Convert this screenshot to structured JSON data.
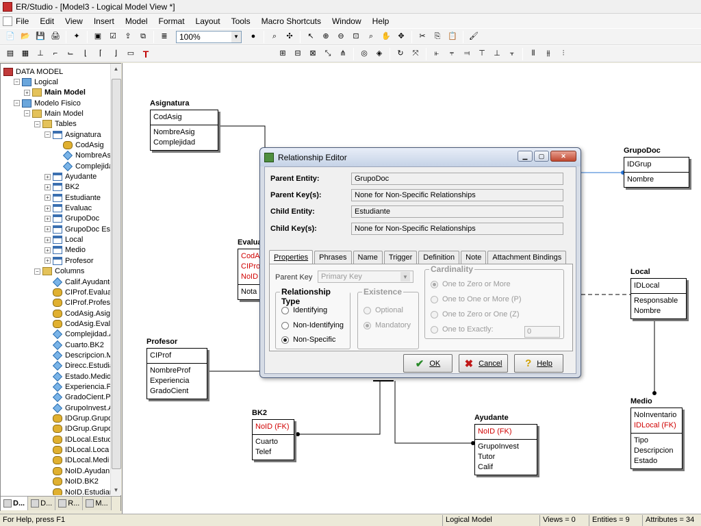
{
  "window": {
    "title": "ER/Studio - [Model3 - Logical Model View *]"
  },
  "menu": [
    "File",
    "Edit",
    "View",
    "Insert",
    "Model",
    "Format",
    "Layout",
    "Tools",
    "Macro Shortcuts",
    "Window",
    "Help"
  ],
  "toolbar": {
    "zoom": "100%"
  },
  "tree": {
    "items": [
      {
        "label": "DATA MODEL",
        "depth": 0,
        "icon": "database-icon",
        "bold": false,
        "expander": ""
      },
      {
        "label": "Logical",
        "depth": 1,
        "icon": "logical-model-icon",
        "bold": false,
        "expander": "−"
      },
      {
        "label": "Main Model",
        "depth": 2,
        "icon": "model-folder-icon",
        "bold": true,
        "expander": "+"
      },
      {
        "label": "Modelo Fisico",
        "depth": 1,
        "icon": "physical-model-icon",
        "bold": false,
        "expander": "−"
      },
      {
        "label": "Main Model",
        "depth": 2,
        "icon": "model-folder-icon",
        "bold": false,
        "expander": "−"
      },
      {
        "label": "Tables",
        "depth": 3,
        "icon": "tables-folder-icon",
        "bold": false,
        "expander": "−"
      },
      {
        "label": "Asignatura",
        "depth": 4,
        "icon": "table-icon",
        "bold": false,
        "expander": "−"
      },
      {
        "label": "CodAsig",
        "depth": 5,
        "icon": "key-column-icon",
        "bold": false,
        "expander": ""
      },
      {
        "label": "NombreAsig",
        "depth": 5,
        "icon": "column-icon",
        "bold": false,
        "expander": ""
      },
      {
        "label": "Complejidad",
        "depth": 5,
        "icon": "column-icon",
        "bold": false,
        "expander": ""
      },
      {
        "label": "Ayudante",
        "depth": 4,
        "icon": "table-icon",
        "bold": false,
        "expander": "+"
      },
      {
        "label": "BK2",
        "depth": 4,
        "icon": "table-icon",
        "bold": false,
        "expander": "+"
      },
      {
        "label": "Estudiante",
        "depth": 4,
        "icon": "table-icon",
        "bold": false,
        "expander": "+"
      },
      {
        "label": "Evaluac",
        "depth": 4,
        "icon": "table-icon",
        "bold": false,
        "expander": "+"
      },
      {
        "label": "GrupoDoc",
        "depth": 4,
        "icon": "table-icon",
        "bold": false,
        "expander": "+"
      },
      {
        "label": "GrupoDoc Es",
        "depth": 4,
        "icon": "table-icon",
        "bold": false,
        "expander": "+"
      },
      {
        "label": "Local",
        "depth": 4,
        "icon": "table-icon",
        "bold": false,
        "expander": "+"
      },
      {
        "label": "Medio",
        "depth": 4,
        "icon": "table-icon",
        "bold": false,
        "expander": "+"
      },
      {
        "label": "Profesor",
        "depth": 4,
        "icon": "table-icon",
        "bold": false,
        "expander": "+"
      },
      {
        "label": "Columns",
        "depth": 3,
        "icon": "columns-folder-icon",
        "bold": false,
        "expander": "−"
      },
      {
        "label": "Calif.Ayudante",
        "depth": 4,
        "icon": "column-icon",
        "bold": false,
        "expander": ""
      },
      {
        "label": "CIProf.Evalua",
        "depth": 4,
        "icon": "key-column-icon",
        "bold": false,
        "expander": ""
      },
      {
        "label": "CIProf.Profes",
        "depth": 4,
        "icon": "key-column-icon",
        "bold": false,
        "expander": ""
      },
      {
        "label": "CodAsig.Asign",
        "depth": 4,
        "icon": "key-column-icon",
        "bold": false,
        "expander": ""
      },
      {
        "label": "CodAsig.Evalu",
        "depth": 4,
        "icon": "key-column-icon",
        "bold": false,
        "expander": ""
      },
      {
        "label": "Complejidad.A",
        "depth": 4,
        "icon": "column-icon",
        "bold": false,
        "expander": ""
      },
      {
        "label": "Cuarto.BK2",
        "depth": 4,
        "icon": "column-icon",
        "bold": false,
        "expander": ""
      },
      {
        "label": "Descripcion.M",
        "depth": 4,
        "icon": "column-icon",
        "bold": false,
        "expander": ""
      },
      {
        "label": "Direcc.Estudia",
        "depth": 4,
        "icon": "column-icon",
        "bold": false,
        "expander": ""
      },
      {
        "label": "Estado.Medio",
        "depth": 4,
        "icon": "column-icon",
        "bold": false,
        "expander": ""
      },
      {
        "label": "Experiencia.P",
        "depth": 4,
        "icon": "column-icon",
        "bold": false,
        "expander": ""
      },
      {
        "label": "GradoCient.Pr",
        "depth": 4,
        "icon": "column-icon",
        "bold": false,
        "expander": ""
      },
      {
        "label": "GrupoInvest.A",
        "depth": 4,
        "icon": "column-icon",
        "bold": false,
        "expander": ""
      },
      {
        "label": "IDGrup.Grupo",
        "depth": 4,
        "icon": "key-column-icon",
        "bold": false,
        "expander": ""
      },
      {
        "label": "IDGrup.Grupo",
        "depth": 4,
        "icon": "key-column-icon",
        "bold": false,
        "expander": ""
      },
      {
        "label": "IDLocal.Estud",
        "depth": 4,
        "icon": "key-column-icon",
        "bold": false,
        "expander": ""
      },
      {
        "label": "IDLocal.Loca",
        "depth": 4,
        "icon": "key-column-icon",
        "bold": false,
        "expander": ""
      },
      {
        "label": "IDLocal.Medi",
        "depth": 4,
        "icon": "key-column-icon",
        "bold": false,
        "expander": ""
      },
      {
        "label": "NoID.Ayudan",
        "depth": 4,
        "icon": "key-column-icon",
        "bold": false,
        "expander": ""
      },
      {
        "label": "NoID.BK2",
        "depth": 4,
        "icon": "key-column-icon",
        "bold": false,
        "expander": ""
      },
      {
        "label": "NoID.Estudian",
        "depth": 4,
        "icon": "key-column-icon",
        "bold": false,
        "expander": ""
      }
    ],
    "tabs": [
      "D...",
      "D...",
      "R...",
      "M..."
    ]
  },
  "entities": [
    {
      "id": "asignatura",
      "name": "Asignatura",
      "keys": [
        {
          "t": "CodAsig",
          "fk": false
        }
      ],
      "attrs": [
        "NombreAsig",
        "Complejidad"
      ]
    },
    {
      "id": "grupodoc",
      "name": "GrupoDoc",
      "keys": [
        {
          "t": "IDGrup",
          "fk": false
        }
      ],
      "attrs": [
        "Nombre"
      ]
    },
    {
      "id": "evaluac",
      "name": "Evalua",
      "keys": [
        {
          "t": "CodAsi",
          "fk": true
        },
        {
          "t": "CIProf",
          "fk": true
        },
        {
          "t": "NoID (",
          "fk": true
        }
      ],
      "attrs": [
        "Nota"
      ]
    },
    {
      "id": "local",
      "name": "Local",
      "keys": [
        {
          "t": "IDLocal",
          "fk": false
        }
      ],
      "attrs": [
        "Responsable",
        "Nombre"
      ]
    },
    {
      "id": "profesor",
      "name": "Profesor",
      "keys": [
        {
          "t": "CIProf",
          "fk": false
        }
      ],
      "attrs": [
        "NombreProf",
        "Experiencia",
        "GradoCient"
      ]
    },
    {
      "id": "medio",
      "name": "Medio",
      "keys": [
        {
          "t": "NoInventario",
          "fk": false
        },
        {
          "t": "IDLocal (FK)",
          "fk": true
        }
      ],
      "attrs": [
        "Tipo",
        "Descripcion",
        "Estado"
      ]
    },
    {
      "id": "bk2",
      "name": "BK2",
      "keys": [
        {
          "t": "NoID (FK)",
          "fk": true
        }
      ],
      "attrs": [
        "Cuarto",
        "Telef"
      ]
    },
    {
      "id": "ayudante",
      "name": "Ayudante",
      "keys": [
        {
          "t": "NoID (FK)",
          "fk": true
        }
      ],
      "attrs": [
        "GrupoInvest",
        "Tutor",
        "Calif"
      ]
    }
  ],
  "dialog": {
    "title": "Relationship Editor",
    "fields": [
      {
        "label": "Parent Entity:",
        "value": "GrupoDoc"
      },
      {
        "label": "Parent Key(s):",
        "value": "None for Non-Specific Relationships"
      },
      {
        "label": "Child Entity:",
        "value": "Estudiante"
      },
      {
        "label": "Child Key(s):",
        "value": "None for Non-Specific Relationships"
      }
    ],
    "tabs": [
      "Properties",
      "Phrases",
      "Name",
      "Trigger",
      "Definition",
      "Note",
      "Attachment Bindings"
    ],
    "parent_key_label": "Parent Key",
    "parent_key_value": "Primary Key",
    "rel_type": {
      "title": "Relationship Type",
      "options": [
        "Identifying",
        "Non-Identifying",
        "Non-Specific"
      ],
      "selected": 2
    },
    "existence": {
      "title": "Existence",
      "options": [
        "Optional",
        "Mandatory"
      ],
      "selected": 1
    },
    "cardinality": {
      "title": "Cardinality",
      "options": [
        "One to Zero or More",
        "One to One or More (P)",
        "One to Zero or One (Z)",
        "One to Exactly:"
      ],
      "selected": 0,
      "exactly": "0"
    },
    "buttons": {
      "ok": "OK",
      "cancel": "Cancel",
      "help": "Help"
    }
  },
  "status": {
    "help": "For Help, press F1",
    "view": "Logical Model",
    "views": "Views = 0",
    "entities": "Entities = 9",
    "attributes": "Attributes = 34"
  },
  "colors": {
    "fk": "#d00000",
    "accent": "#2a74d2"
  }
}
